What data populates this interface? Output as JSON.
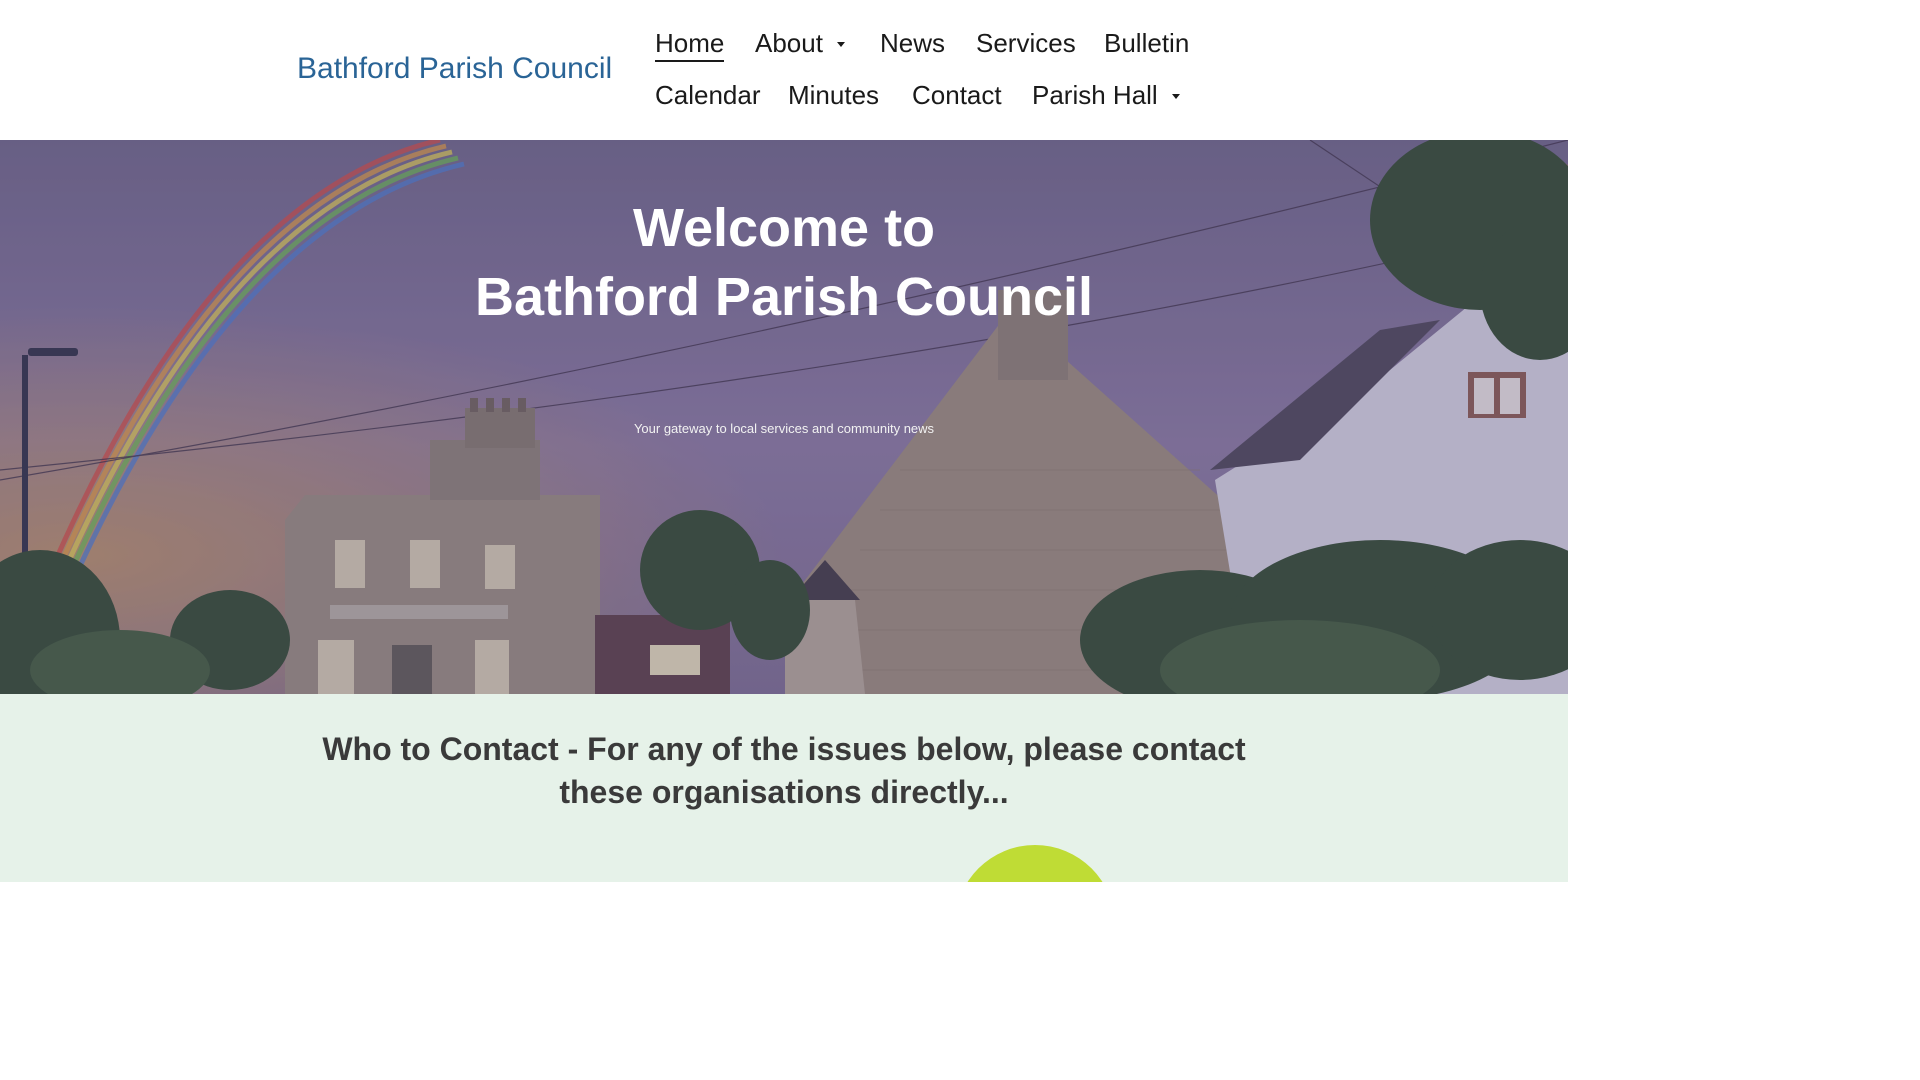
{
  "header": {
    "site_title": "Bathford Parish Council",
    "nav": [
      {
        "label": "Home",
        "current": true
      },
      {
        "label": "About",
        "has_dropdown": true
      },
      {
        "label": "News"
      },
      {
        "label": "Services"
      },
      {
        "label": "Bulletin"
      },
      {
        "label": "Calendar"
      },
      {
        "label": "Minutes"
      },
      {
        "label": "Contact"
      },
      {
        "label": "Parish Hall",
        "has_dropdown": true
      }
    ]
  },
  "hero": {
    "title_line1": "Welcome to",
    "title_line2": "Bathford Parish Council",
    "subtitle": "Your gateway to local services and community news"
  },
  "contact_section": {
    "heading": "Who to Contact - For any of the issues below, please contact these organisations directly..."
  },
  "colors": {
    "site_title": "#2a6496",
    "section_background": "#e6f2e9",
    "accent_circle": "#bfdc35"
  },
  "icons": {
    "dropdown": "caret-down-icon"
  }
}
